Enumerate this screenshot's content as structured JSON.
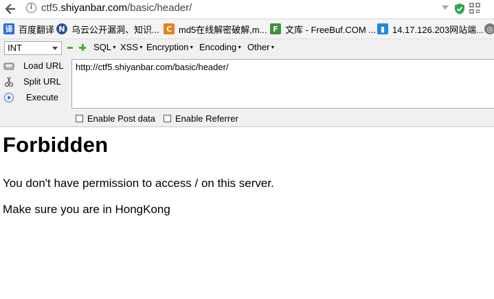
{
  "browser": {
    "url_prefix": "ctf5.",
    "url_host": "shiyanbar.com",
    "url_path": "/basic/header/"
  },
  "bookmarks": [
    {
      "icon": "baidu-translate-icon",
      "label": "百度翻译",
      "color": "#2b6de1"
    },
    {
      "icon": "wooyun-icon",
      "label": "乌云公开漏洞、知识...",
      "color": "#2c4f9e"
    },
    {
      "icon": "cmd5-icon",
      "label": "md5在线解密破解,m...",
      "color": "#e8801e"
    },
    {
      "icon": "freebuf-icon",
      "label": "文库 - FreeBuf.COM ...",
      "color": "#3f8f3f"
    },
    {
      "icon": "site-icon",
      "label": "14.17.126.203网站端...",
      "color": "#1e88e5"
    }
  ],
  "hackbar": {
    "select_value": "INT",
    "menus": [
      "SQL",
      "XSS",
      "Encryption",
      "Encoding",
      "Other"
    ],
    "load_url": "Load URL",
    "split_url": "Split URL",
    "execute": "Execute",
    "url_value": "http://ctf5.shiyanbar.com/basic/header/",
    "enable_post": "Enable Post data",
    "enable_referrer": "Enable Referrer"
  },
  "page": {
    "heading": "Forbidden",
    "message": "You don't have permission to access / on this server.",
    "hint": "Make sure you are in HongKong"
  }
}
